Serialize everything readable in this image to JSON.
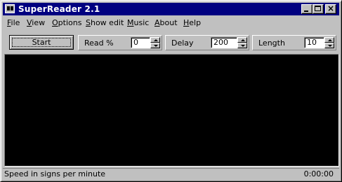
{
  "window": {
    "title": "SuperReader 2.1"
  },
  "menu": [
    {
      "u": "F",
      "rest": "ile"
    },
    {
      "u": "V",
      "rest": "iew"
    },
    {
      "u": "O",
      "rest": "ptions"
    },
    {
      "u": "S",
      "rest": "how edit"
    },
    {
      "u": "M",
      "rest": "usic"
    },
    {
      "u": "A",
      "rest": "bout"
    },
    {
      "u": "H",
      "rest": "elp"
    }
  ],
  "toolbar": {
    "start_label": "Start",
    "read": {
      "label": "Read  %",
      "value": "0"
    },
    "delay": {
      "label": "Delay",
      "value": "200"
    },
    "length": {
      "label": "Length",
      "value": "10"
    }
  },
  "status": {
    "left": "Speed in signs per minute",
    "right": "0:00:00"
  },
  "colors": {
    "titlebar": "#000080",
    "display": "#000000",
    "face": "#c0c0c0"
  }
}
